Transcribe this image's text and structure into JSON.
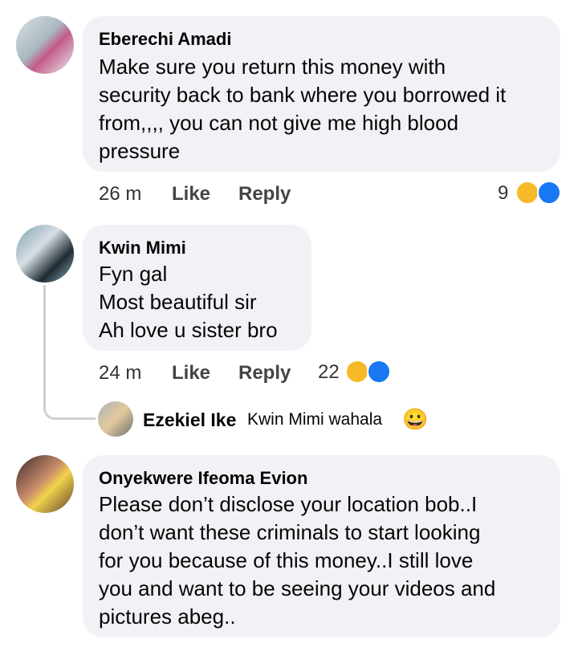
{
  "comments": [
    {
      "author": "Eberechi Amadi",
      "lines": [
        "Make sure you return this money with",
        "security back to bank where you borrowed it",
        "from,,,,     you can not give me high blood",
        "pressure"
      ],
      "time": "26 m",
      "like_label": "Like",
      "reply_label": "Reply",
      "reaction_count": "9"
    },
    {
      "author": "Kwin Mimi",
      "lines": [
        "Fyn gal",
        "Most beautiful sir",
        "Ah love u sister bro"
      ],
      "time": "24 m",
      "like_label": "Like",
      "reply_label": "Reply",
      "reaction_count": "22"
    },
    {
      "author": "Onyekwere Ifeoma Evion",
      "lines": [
        "Please don’t disclose your location bob..I",
        "don’t want these criminals to start looking",
        "for you because of this money..I still love",
        "you and want to be seeing your videos and",
        "pictures abeg.."
      ]
    }
  ],
  "reply_preview": {
    "author": "Ezekiel Ike",
    "text": "Kwin Mimi wahala",
    "emoji": "😀"
  },
  "colors": {
    "bubble": "#f0f2f5",
    "like_blue": "#1877f2",
    "haha_yellow": "#f7b928",
    "thread_line": "#ced0d4"
  },
  "icons": [
    "haha-reaction-icon",
    "like-reaction-icon",
    "grinning-emoji-icon"
  ]
}
